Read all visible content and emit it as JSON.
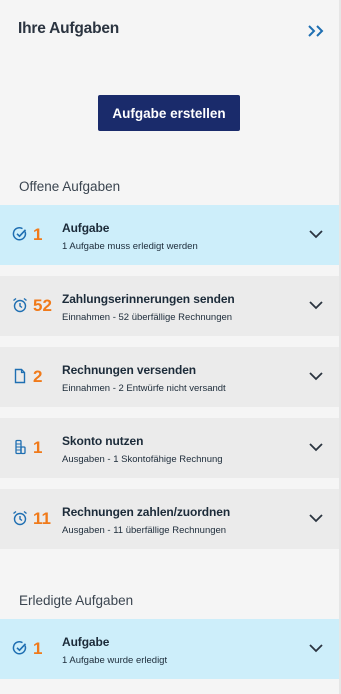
{
  "header": {
    "title": "Ihre Aufgaben",
    "collapse_icon": "double-chevron-right-icon"
  },
  "create_button": {
    "label": "Aufgabe erstellen"
  },
  "open_section": {
    "title": "Offene Aufgaben",
    "tasks": [
      {
        "icon": "check-circle-icon",
        "count": "1",
        "title": "Aufgabe",
        "subtitle": "1 Aufgabe muss erledigt werden"
      },
      {
        "icon": "alarm-clock-icon",
        "count": "52",
        "title": "Zahlungserinnerungen senden",
        "subtitle": "Einnahmen - 52 überfällige Rechnungen"
      },
      {
        "icon": "document-icon",
        "count": "2",
        "title": "Rechnungen versenden",
        "subtitle": "Einnahmen - 2 Entwürfe nicht versandt"
      },
      {
        "icon": "coins-icon",
        "count": "1",
        "title": "Skonto nutzen",
        "subtitle": "Ausgaben - 1 Skontofähige Rechnung"
      },
      {
        "icon": "alarm-clock-icon",
        "count": "11",
        "title": "Rechnungen zahlen/zuordnen",
        "subtitle": "Ausgaben - 11 überfällige Rechnungen"
      }
    ]
  },
  "done_section": {
    "title": "Erledigte Aufgaben",
    "tasks": [
      {
        "icon": "check-circle-icon",
        "count": "1",
        "title": "Aufgabe",
        "subtitle": "1 Aufgabe wurde erledigt"
      }
    ]
  },
  "colors": {
    "accent_orange": "#f07a1a",
    "button_navy": "#1a2b6b",
    "active_row": "#cdeefa",
    "icon_blue": "#1f6fb2"
  }
}
